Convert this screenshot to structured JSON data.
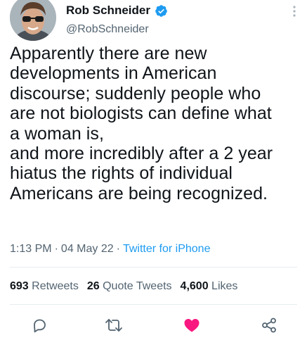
{
  "author": {
    "display_name": "Rob Schneider",
    "handle": "@RobSchneider",
    "verified": true
  },
  "tweet": {
    "text": "Apparently there are new\ndevelopments in American\ndiscourse; suddenly people who\nare not biologists can define what\na woman is,\nand more incredibly after a 2 year\nhiatus the rights of individual\nAmericans are being recognized.",
    "time": "1:13 PM",
    "date": "04 May 22",
    "source": "Twitter for iPhone",
    "separator": "·"
  },
  "stats": {
    "retweets_count": "693",
    "retweets_label": "Retweets",
    "quotes_count": "26",
    "quotes_label": "Quote Tweets",
    "likes_count": "4,600",
    "likes_label": "Likes"
  },
  "colors": {
    "text": "#0f1419",
    "secondary": "#536471",
    "link": "#1d9bf0",
    "like": "#f91880",
    "divider": "#e6ecf0"
  },
  "icons": [
    "verified-badge-icon",
    "more-icon",
    "reply-icon",
    "retweet-icon",
    "like-icon",
    "share-icon"
  ]
}
